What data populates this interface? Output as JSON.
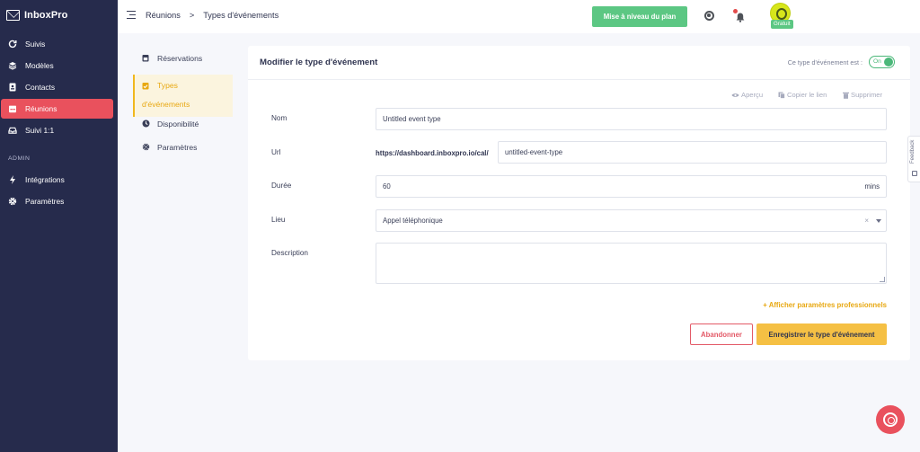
{
  "app": {
    "name": "InboxPro"
  },
  "sidebar": {
    "items": [
      {
        "label": "Suivis",
        "icon": "refresh-icon"
      },
      {
        "label": "Modèles",
        "icon": "layers-icon"
      },
      {
        "label": "Contacts",
        "icon": "contact-card-icon"
      },
      {
        "label": "Réunions",
        "icon": "calendar-icon",
        "active": true
      },
      {
        "label": "Suivi 1:1",
        "icon": "inbox-tray-icon"
      }
    ],
    "section_admin": "ADMIN",
    "admin_items": [
      {
        "label": "Intégrations",
        "icon": "bolt-icon"
      },
      {
        "label": "Paramètres",
        "icon": "gear-icon"
      }
    ],
    "active_color": "#e9515d",
    "background": "#262b4c"
  },
  "header": {
    "breadcrumb": [
      "Réunions",
      ">",
      "Types d'événements"
    ],
    "upgrade_label": "Mise à niveau du plan",
    "avatar_badge": "Gratuit"
  },
  "subnav": {
    "items": [
      {
        "label": "Réservations",
        "icon": "calendar-icon"
      },
      {
        "label_line1": "Types",
        "label_line2": "d'événements",
        "icon": "calendar-check-icon",
        "active": true
      },
      {
        "label": "Disponibilité",
        "icon": "clock-icon"
      },
      {
        "label": "Paramètres",
        "icon": "gear-icon"
      }
    ]
  },
  "form": {
    "title": "Modifier le type d'événement",
    "status_text": "Ce type d'événement est :",
    "status_toggle": "On",
    "actions": {
      "preview": "Aperçu",
      "copy": "Copier le lien",
      "delete": "Supprimer"
    },
    "name_label": "Nom",
    "name_value": "Untitled event type",
    "url_label": "Url",
    "url_prefix": "https://dashboard.inboxpro.io/cal/",
    "url_value": "untitled-event-type",
    "duration_label": "Durée",
    "duration_value": "60",
    "duration_unit": "mins",
    "location_label": "Lieu",
    "location_value": "Appel téléphonique",
    "description_label": "Description",
    "description_value": "",
    "pro_settings_link": "+ Afficher paramètres professionnels",
    "cancel_label": "Abandonner",
    "save_label": "Enregistrer le type d'événement"
  },
  "feedback_label": "Feedback",
  "colors": {
    "accent_yellow": "#f5c044",
    "green": "#5cc783",
    "danger": "#e35a67"
  }
}
